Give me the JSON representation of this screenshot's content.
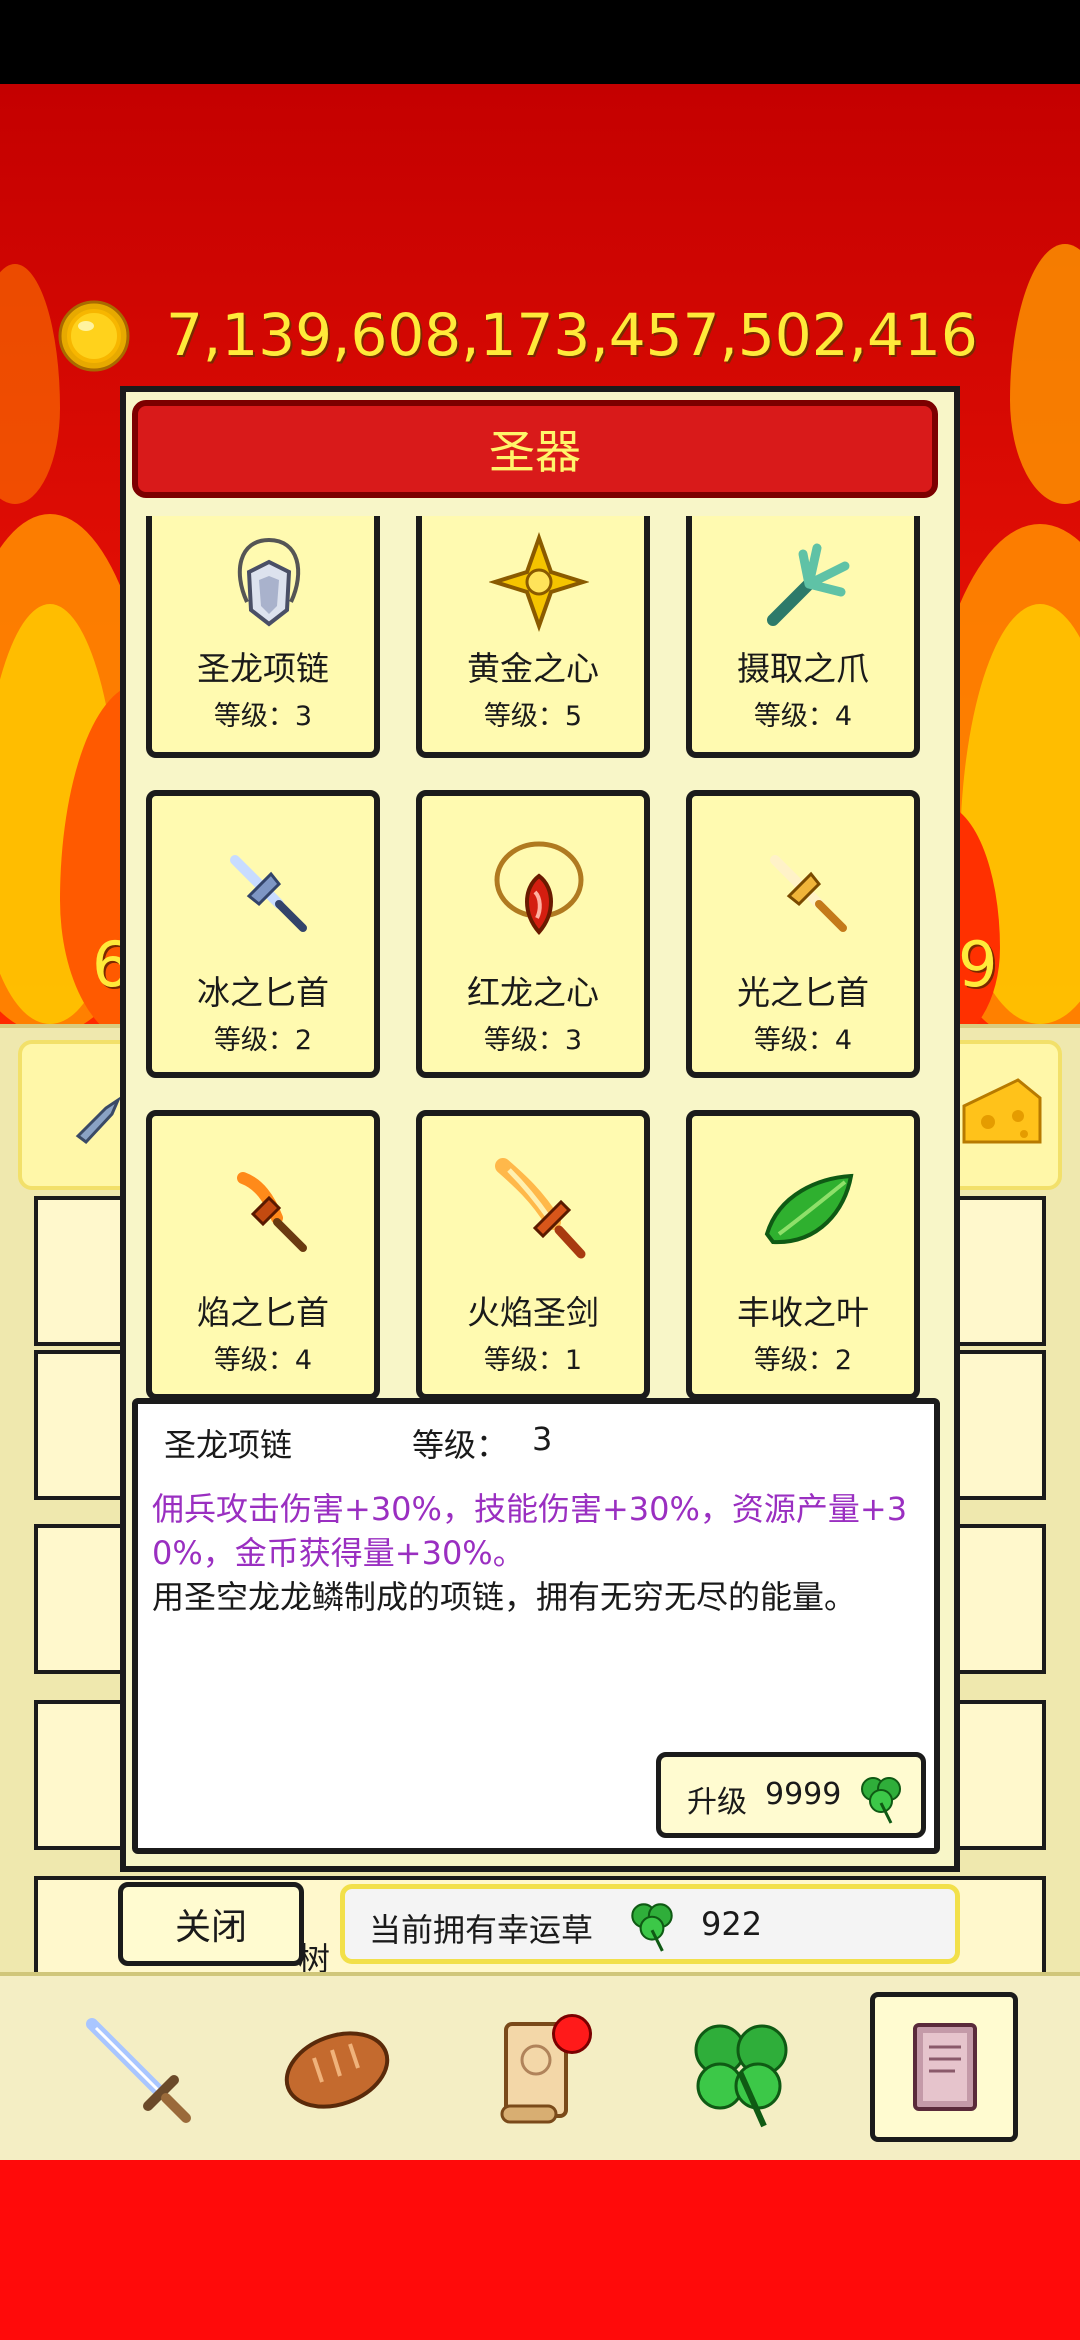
{
  "gold": {
    "amount": "7,139,608,173,457,502,416",
    "icon": "gold-coin-icon"
  },
  "bg_numbers": {
    "left": "6",
    "right": "9"
  },
  "bg_list_partial_text": "树",
  "dialog": {
    "title": "圣器",
    "items": [
      {
        "name": "圣龙项链",
        "level": "等级：3",
        "icon": "dragon-necklace-icon"
      },
      {
        "name": "黄金之心",
        "level": "等级：5",
        "icon": "golden-heart-icon"
      },
      {
        "name": "摄取之爪",
        "level": "等级：4",
        "icon": "claw-icon"
      },
      {
        "name": "冰之匕首",
        "level": "等级：2",
        "icon": "ice-dagger-icon"
      },
      {
        "name": "红龙之心",
        "level": "等级：3",
        "icon": "red-dragon-heart-icon"
      },
      {
        "name": "光之匕首",
        "level": "等级：4",
        "icon": "light-dagger-icon"
      },
      {
        "name": "焰之匕首",
        "level": "等级：4",
        "icon": "flame-dagger-icon"
      },
      {
        "name": "火焰圣剑",
        "level": "等级：1",
        "icon": "flame-sword-icon"
      },
      {
        "name": "丰收之叶",
        "level": "等级：2",
        "icon": "harvest-leaf-icon"
      }
    ],
    "detail": {
      "name": "圣龙项链",
      "level_label": "等级：",
      "level_value": "3",
      "effect_line1": "佣兵攻击伤害+30%，技能伤害+30%，资源产量+3",
      "effect_line2": "0%，金币获得量+30%。",
      "description": "用圣空龙龙鳞制成的项链，拥有无穷无尽的能量。",
      "upgrade_label": "升级",
      "upgrade_cost": "9999"
    },
    "close_label": "关闭",
    "clover_label": "当前拥有幸运草",
    "clover_count": "922"
  },
  "nav": [
    {
      "icon": "sword-icon",
      "badge": false
    },
    {
      "icon": "bread-icon",
      "badge": false
    },
    {
      "icon": "scroll-icon",
      "badge": true
    },
    {
      "icon": "clover-icon",
      "badge": false
    },
    {
      "icon": "book-icon",
      "badge": false,
      "selected": true
    }
  ],
  "colors": {
    "effect_text": "#9a2fc1",
    "title_bar": "#d91a1a",
    "title_text": "#fff56b",
    "gold_text": "#ffea3a",
    "badge": "#ff1a1a"
  }
}
